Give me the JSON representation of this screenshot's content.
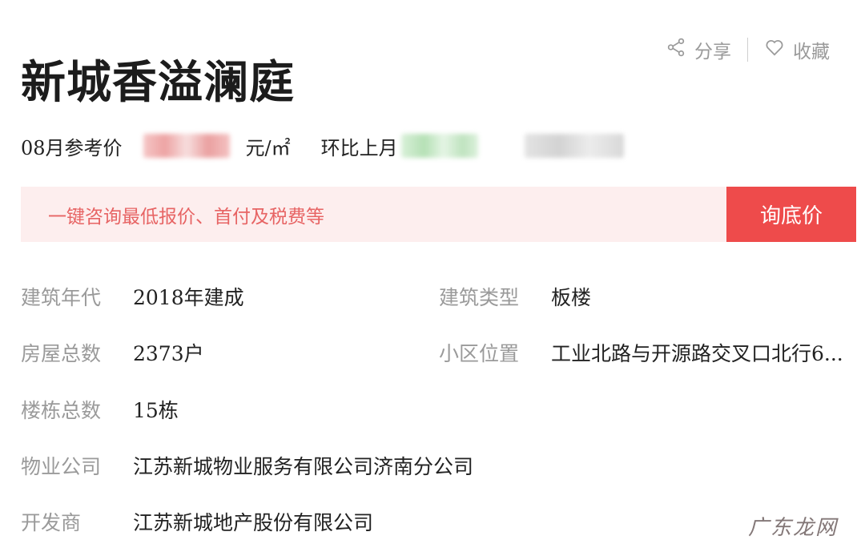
{
  "title": "新城香溢澜庭",
  "actions": {
    "share_label": "分享",
    "favorite_label": "收藏"
  },
  "price": {
    "month_label": "08月参考价",
    "unit": "元/㎡",
    "mom_label": "环比上月"
  },
  "banner": {
    "text": "一键咨询最低报价、首付及税费等",
    "button_label": "询底价"
  },
  "info": {
    "build_year": {
      "label": "建筑年代",
      "value": "2018年建成"
    },
    "build_type": {
      "label": "建筑类型",
      "value": "板楼"
    },
    "households": {
      "label": "房屋总数",
      "value": "2373户"
    },
    "location": {
      "label": "小区位置",
      "value": "工业北路与开源路交叉口北行6..."
    },
    "buildings": {
      "label": "楼栋总数",
      "value": "15栋"
    },
    "property_company": {
      "label": "物业公司",
      "value": "江苏新城物业服务有限公司济南分公司"
    },
    "developer": {
      "label": "开发商",
      "value": "江苏新城地产股份有限公司"
    }
  },
  "watermark": "广东龙网",
  "colors": {
    "accent": "#ee4b4b",
    "banner_bg": "#fdeeee",
    "label_gray": "#9a9a9a"
  },
  "icons": {
    "share": "share-icon",
    "favorite": "heart-icon"
  }
}
